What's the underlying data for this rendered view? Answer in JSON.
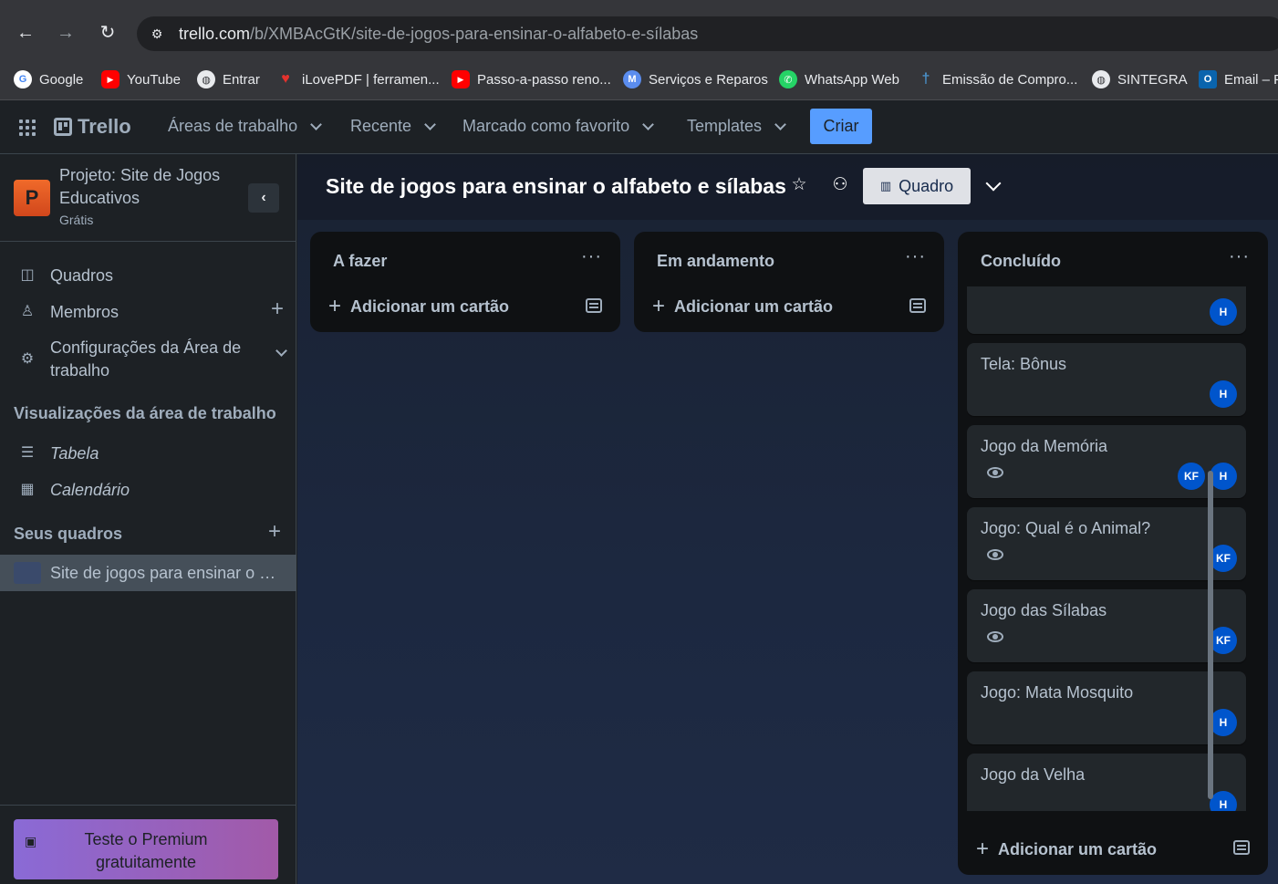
{
  "browser": {
    "url_domain": "trello.com",
    "url_path": "/b/XMBAcGtK/site-de-jogos-para-ensinar-o-alfabeto-e-sílabas",
    "bookmarks": [
      {
        "label": "Google",
        "icon": "G",
        "color": "#ffffff"
      },
      {
        "label": "YouTube",
        "icon": "▶",
        "color": "#ff0000"
      },
      {
        "label": "Entrar",
        "icon": "●",
        "color": "#e8eaed"
      },
      {
        "label": "iLovePDF | ferramen...",
        "icon": "♥",
        "color": "#e5322d"
      },
      {
        "label": "Passo-a-passo reno...",
        "icon": "▶",
        "color": "#ff0000"
      },
      {
        "label": "Serviços e Reparos",
        "icon": "M",
        "color": "#5b8def"
      },
      {
        "label": "WhatsApp Web",
        "icon": "✆",
        "color": "#25d366"
      },
      {
        "label": "Emissão de Compro...",
        "icon": "†",
        "color": "#4a90c8"
      },
      {
        "label": "SINTEGRA",
        "icon": "●",
        "color": "#e8eaed"
      },
      {
        "label": "Email – P",
        "icon": "O",
        "color": "#0a64ad"
      }
    ]
  },
  "header": {
    "logo": "Trello",
    "menu": {
      "workspaces": "Áreas de trabalho",
      "recent": "Recente",
      "starred": "Marcado como favorito",
      "templates": "Templates"
    },
    "create": "Criar"
  },
  "sidebar": {
    "workspace_initial": "P",
    "workspace_name": "Projeto:  Site de Jogos Educativos",
    "workspace_plan": "Grátis",
    "items": {
      "boards": "Quadros",
      "members": "Membros",
      "settings": "Configurações da Área de trabalho"
    },
    "views_title": "Visualizações da área de trabalho",
    "views": {
      "table": "Tabela",
      "calendar": "Calendário"
    },
    "your_boards_title": "Seus quadros",
    "active_board": "Site de jogos para ensinar o alfabeto e sílabas",
    "premium": "Teste o Premium gratuitamente"
  },
  "board": {
    "title": "Site de jogos para ensinar o alfabeto e sílabas",
    "view_label": "Quadro",
    "colors": {
      "accent": "#579dff",
      "avatar": "#0055cc"
    },
    "lists": [
      {
        "title": "A fazer",
        "add_card": "Adicionar um cartão"
      },
      {
        "title": "Em andamento",
        "add_card": "Adicionar um cartão"
      },
      {
        "title": "Concluído",
        "add_card": "Adicionar um cartão",
        "cards": [
          {
            "title": "",
            "watch": false,
            "members": [
              "H"
            ]
          },
          {
            "title": "Tela: Bônus",
            "watch": false,
            "members": [
              "H"
            ]
          },
          {
            "title": "Jogo da Memória",
            "watch": true,
            "members": [
              "KF",
              "H"
            ]
          },
          {
            "title": "Jogo: Qual é o Animal?",
            "watch": true,
            "members": [
              "KF"
            ]
          },
          {
            "title": "Jogo das Sílabas",
            "watch": true,
            "members": [
              "KF"
            ]
          },
          {
            "title": "Jogo: Mata Mosquito",
            "watch": false,
            "members": [
              "H"
            ]
          },
          {
            "title": "Jogo da Velha",
            "watch": false,
            "members": [
              "H"
            ]
          }
        ]
      }
    ]
  }
}
